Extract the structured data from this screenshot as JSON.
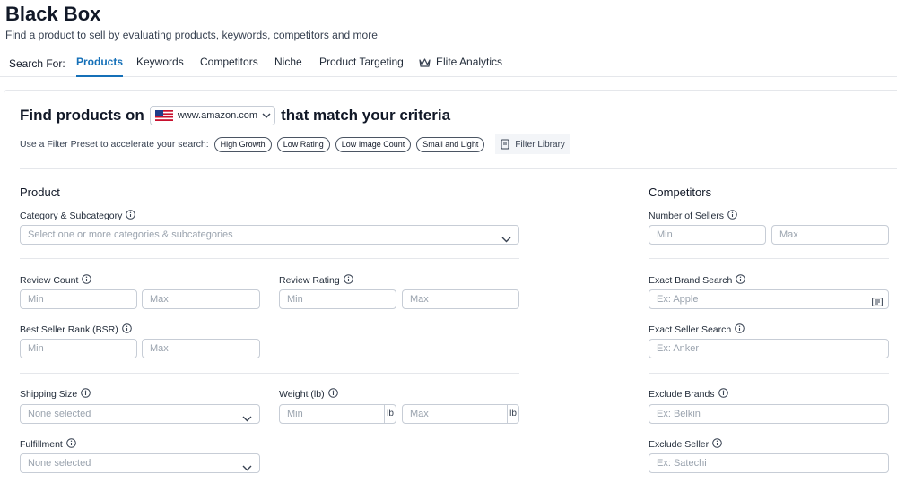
{
  "header": {
    "title": "Black Box",
    "subtitle": "Find a product to sell by evaluating products, keywords, competitors and more"
  },
  "tabs": {
    "lead": "Search For:",
    "items": [
      {
        "label": "Products"
      },
      {
        "label": "Keywords"
      },
      {
        "label": "Competitors"
      },
      {
        "label": "Niche"
      },
      {
        "label": "Product Targeting"
      },
      {
        "label": "Elite Analytics",
        "icon": "crown-icon"
      }
    ]
  },
  "find": {
    "before": "Find products on",
    "marketplace": "www.amazon.com",
    "marketplace_flag": "us-flag-icon",
    "after": "that match your criteria"
  },
  "presets": {
    "lead": "Use a Filter Preset to accelerate your search:",
    "chips": [
      "High Growth",
      "Low Rating",
      "Low Image Count",
      "Small and Light"
    ],
    "library": "Filter Library"
  },
  "product": {
    "title": "Product",
    "category": {
      "label": "Category & Subcategory",
      "placeholder": "Select one or more categories & subcategories"
    },
    "review_count": {
      "label": "Review Count",
      "min": "Min",
      "max": "Max"
    },
    "review_rating": {
      "label": "Review Rating",
      "min": "Min",
      "max": "Max"
    },
    "bsr": {
      "label": "Best Seller Rank (BSR)",
      "min": "Min",
      "max": "Max"
    },
    "shipping_size": {
      "label": "Shipping Size",
      "placeholder": "None selected"
    },
    "weight": {
      "label": "Weight (lb)",
      "min": "Min",
      "max": "Max",
      "unit": "lb"
    },
    "fulfillment": {
      "label": "Fulfillment",
      "placeholder": "None selected"
    }
  },
  "competitors": {
    "title": "Competitors",
    "num_sellers": {
      "label": "Number of Sellers",
      "min": "Min",
      "max": "Max"
    },
    "exact_brand": {
      "label": "Exact Brand Search",
      "placeholder": "Ex: Apple"
    },
    "exact_seller": {
      "label": "Exact Seller Search",
      "placeholder": "Ex: Anker"
    },
    "exclude_brands": {
      "label": "Exclude Brands",
      "placeholder": "Ex: Belkin"
    },
    "exclude_seller": {
      "label": "Exclude Seller",
      "placeholder": "Ex: Satechi"
    }
  },
  "colors": {
    "accent": "#1570b8",
    "border": "#c7cdd6",
    "placeholder": "#9aa3ae"
  }
}
